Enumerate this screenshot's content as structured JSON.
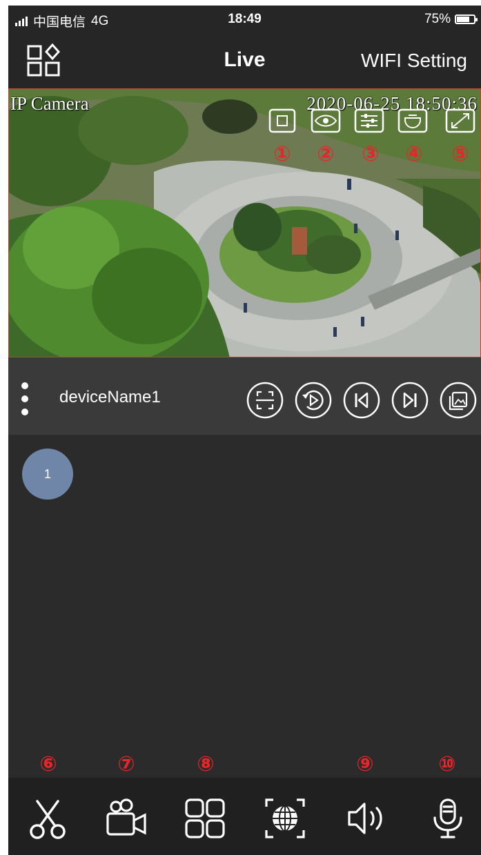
{
  "status_bar": {
    "carrier": "中国电信",
    "network": "4G",
    "time": "18:49",
    "battery_text": "75%",
    "battery_level": 0.75
  },
  "nav": {
    "title": "Live",
    "right_label": "WIFI Setting",
    "menu_icon": "grid-diamond-icon"
  },
  "video": {
    "camera_label": "IP Camera",
    "timestamp": "2020-06-25 18:50:36",
    "overlay_buttons": [
      {
        "icon": "record-square-icon",
        "number": "①"
      },
      {
        "icon": "eye-icon",
        "number": "②"
      },
      {
        "icon": "sliders-icon",
        "number": "③"
      },
      {
        "icon": "ptz-dome-icon",
        "number": "④"
      },
      {
        "icon": "fullscreen-icon",
        "number": "⑤"
      }
    ]
  },
  "device_bar": {
    "device_name": "deviceName1",
    "controls": [
      "scan-frame-icon",
      "playback-icon",
      "previous-icon",
      "next-icon",
      "gallery-icon"
    ]
  },
  "channels": [
    {
      "label": "1",
      "color": "#6f86a8"
    }
  ],
  "toolbar": {
    "items": [
      {
        "icon": "scissors-icon",
        "number": "⑥"
      },
      {
        "icon": "video-camera-icon",
        "number": "⑦"
      },
      {
        "icon": "multi-grid-icon",
        "number": "⑧"
      },
      {
        "icon": "ptz-globe-icon",
        "number": ""
      },
      {
        "icon": "speaker-icon",
        "number": "⑨"
      },
      {
        "icon": "microphone-icon",
        "number": "⑩"
      }
    ]
  },
  "colors": {
    "accent_red": "#e6262b",
    "bar_bg": "#262626",
    "panel_bg": "#3a3a3a",
    "channel_blue": "#6f86a8"
  }
}
